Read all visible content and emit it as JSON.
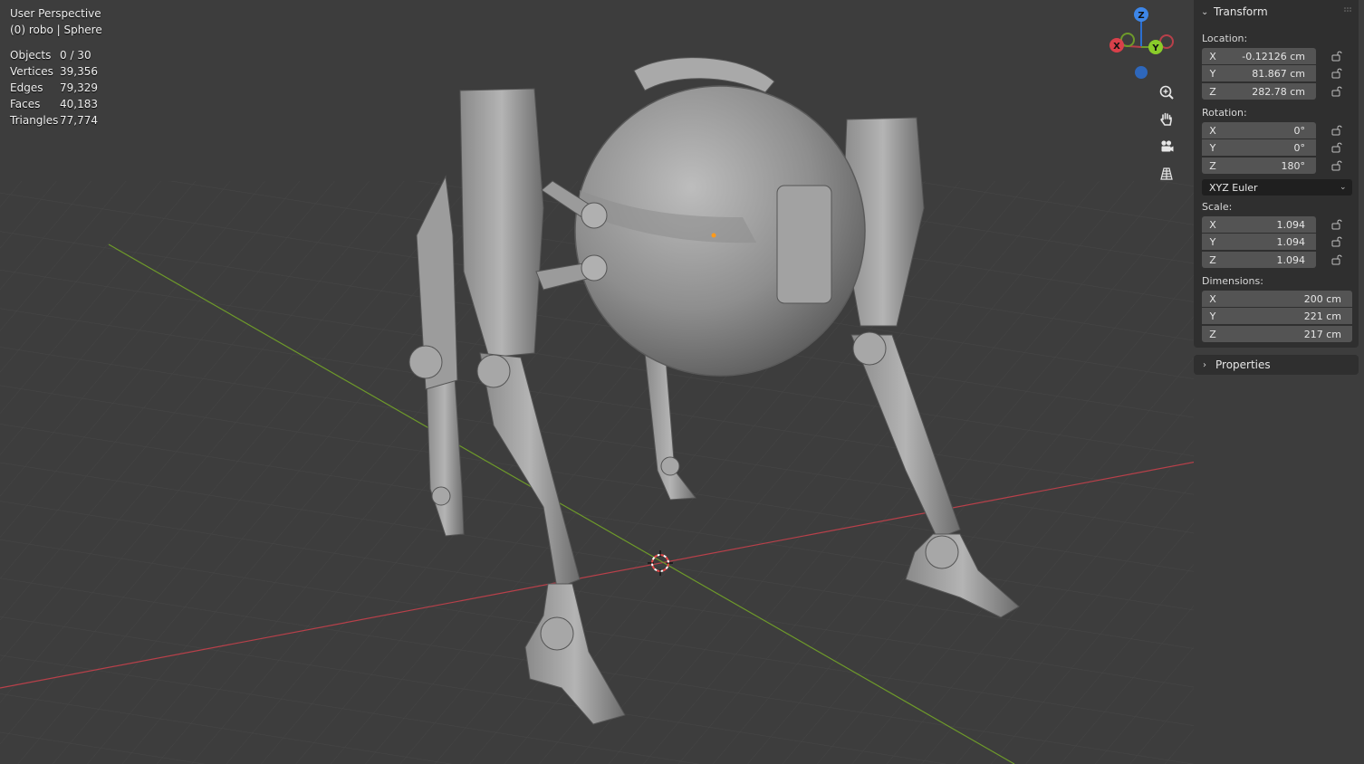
{
  "viewport": {
    "view_name": "User Perspective",
    "object_info": "(0) robo | Sphere",
    "stats": [
      {
        "label": "Objects",
        "value": "0 / 30"
      },
      {
        "label": "Vertices",
        "value": "39,356"
      },
      {
        "label": "Edges",
        "value": "79,329"
      },
      {
        "label": "Faces",
        "value": "40,183"
      },
      {
        "label": "Triangles",
        "value": "77,774"
      }
    ],
    "gizmo": {
      "x_label": "X",
      "y_label": "Y",
      "z_label": "Z"
    },
    "nav_tools": [
      "zoom-icon",
      "hand-pan-icon",
      "camera-icon",
      "grid-ortho-icon"
    ],
    "colors": {
      "background": "#3d3d3d",
      "x_axis": "#b8404a",
      "y_axis": "#6e9a2a",
      "z_axis": "#2b6fd1",
      "mesh": "#9a9a9a"
    }
  },
  "npanel": {
    "transform_title": "Transform",
    "location_label": "Location:",
    "location": [
      {
        "axis": "X",
        "value": "-0.12126 cm"
      },
      {
        "axis": "Y",
        "value": "81.867 cm"
      },
      {
        "axis": "Z",
        "value": "282.78 cm"
      }
    ],
    "rotation_label": "Rotation:",
    "rotation": [
      {
        "axis": "X",
        "value": "0°"
      },
      {
        "axis": "Y",
        "value": "0°"
      },
      {
        "axis": "Z",
        "value": "180°"
      }
    ],
    "rotation_mode": "XYZ Euler",
    "scale_label": "Scale:",
    "scale": [
      {
        "axis": "X",
        "value": "1.094"
      },
      {
        "axis": "Y",
        "value": "1.094"
      },
      {
        "axis": "Z",
        "value": "1.094"
      }
    ],
    "dimensions_label": "Dimensions:",
    "dimensions": [
      {
        "axis": "X",
        "value": "200 cm"
      },
      {
        "axis": "Y",
        "value": "221 cm"
      },
      {
        "axis": "Z",
        "value": "217 cm"
      }
    ],
    "properties_title": "Properties"
  }
}
